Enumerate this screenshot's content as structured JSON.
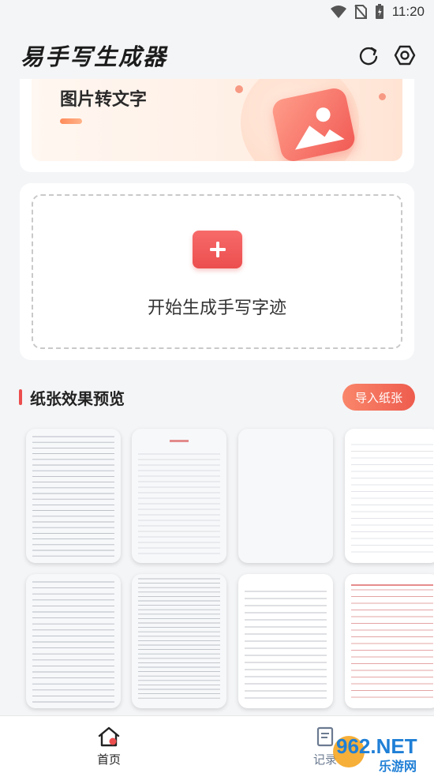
{
  "status_bar": {
    "time": "11:20"
  },
  "header": {
    "app_title": "易手写生成器",
    "icons": [
      "history-icon",
      "settings-icon"
    ]
  },
  "banner": {
    "title": "图片转文字",
    "icon": "image-icon"
  },
  "start": {
    "label": "开始生成手写字迹",
    "icon": "plus-icon"
  },
  "papers_section": {
    "title": "纸张效果预览",
    "import_label": "导入纸张",
    "paper_types": [
      "ruled-gray",
      "red-header-ruled",
      "blank",
      "faint-ruled",
      "ruled-gray-2",
      "dense-ruled",
      "white-ruled",
      "red-ruled"
    ]
  },
  "bottom_nav": {
    "items": [
      {
        "label": "首页",
        "icon": "home-icon",
        "active": true
      },
      {
        "label": "记录",
        "icon": "record-icon",
        "active": false
      }
    ]
  },
  "watermark": {
    "text": "962.NET",
    "subtext": "乐游网"
  },
  "colors": {
    "accent": "#ec4e4e",
    "import_gradient": "#f9866a",
    "background": "#f4f5f7"
  }
}
